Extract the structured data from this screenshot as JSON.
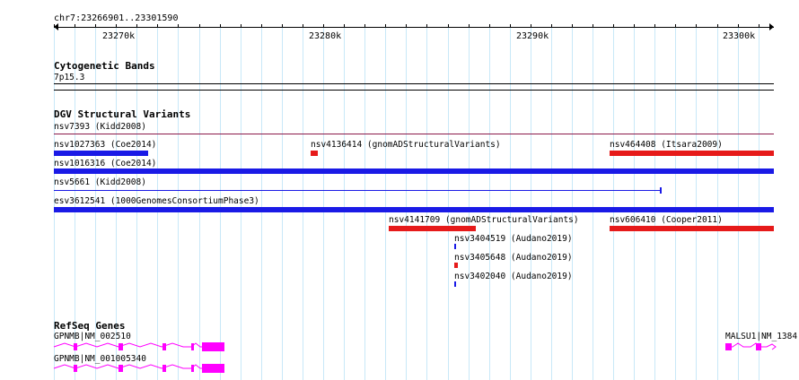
{
  "ruler": {
    "location": "chr7:23266901..23301590",
    "ticks": [
      "23270k",
      "23280k",
      "23290k",
      "23300k"
    ]
  },
  "tracks": {
    "cytoband": {
      "title": "Cytogenetic Bands",
      "band_label": "7p15.3"
    },
    "dgv": {
      "title": "DGV Structural Variants",
      "features": [
        {
          "id": "nsv7393",
          "label": "nsv7393 (Kidd2008)",
          "color": "#8b1a4a",
          "kind": "thin"
        },
        {
          "id": "nsv1027363",
          "label": "nsv1027363 (Coe2014)",
          "color": "#1a1ae6",
          "kind": "bar"
        },
        {
          "id": "nsv4136414",
          "label": "nsv4136414 (gnomADStructuralVariants)",
          "color": "#e61a1a",
          "kind": "bar"
        },
        {
          "id": "nsv464408",
          "label": "nsv464408 (Itsara2009)",
          "color": "#e61a1a",
          "kind": "bar"
        },
        {
          "id": "nsv1016316",
          "label": "nsv1016316 (Coe2014)",
          "color": "#1a1ae6",
          "kind": "bar"
        },
        {
          "id": "nsv5661",
          "label": "nsv5661 (Kidd2008)",
          "color": "#1a1ae6",
          "kind": "thin"
        },
        {
          "id": "esv3612541",
          "label": "esv3612541 (1000GenomesConsortiumPhase3)",
          "color": "#1a1ae6",
          "kind": "bar"
        },
        {
          "id": "nsv4141709",
          "label": "nsv4141709 (gnomADStructuralVariants)",
          "color": "#e61a1a",
          "kind": "bar"
        },
        {
          "id": "nsv606410",
          "label": "nsv606410 (Cooper2011)",
          "color": "#e61a1a",
          "kind": "bar"
        },
        {
          "id": "nsv3404519",
          "label": "nsv3404519 (Audano2019)",
          "color": "#1a1ae6",
          "kind": "tick"
        },
        {
          "id": "nsv3405648",
          "label": "nsv3405648 (Audano2019)",
          "color": "#e61a1a",
          "kind": "tick"
        },
        {
          "id": "nsv3402040",
          "label": "nsv3402040 (Audano2019)",
          "color": "#1a1ae6",
          "kind": "tick"
        }
      ]
    },
    "refseq": {
      "title": "RefSeq Genes",
      "color": "#ff00ff",
      "genes": [
        {
          "label": "GPNMB|NM_002510"
        },
        {
          "label": "GPNMB|NM_001005340"
        },
        {
          "label": "MALSU1|NM_1384"
        }
      ]
    }
  }
}
